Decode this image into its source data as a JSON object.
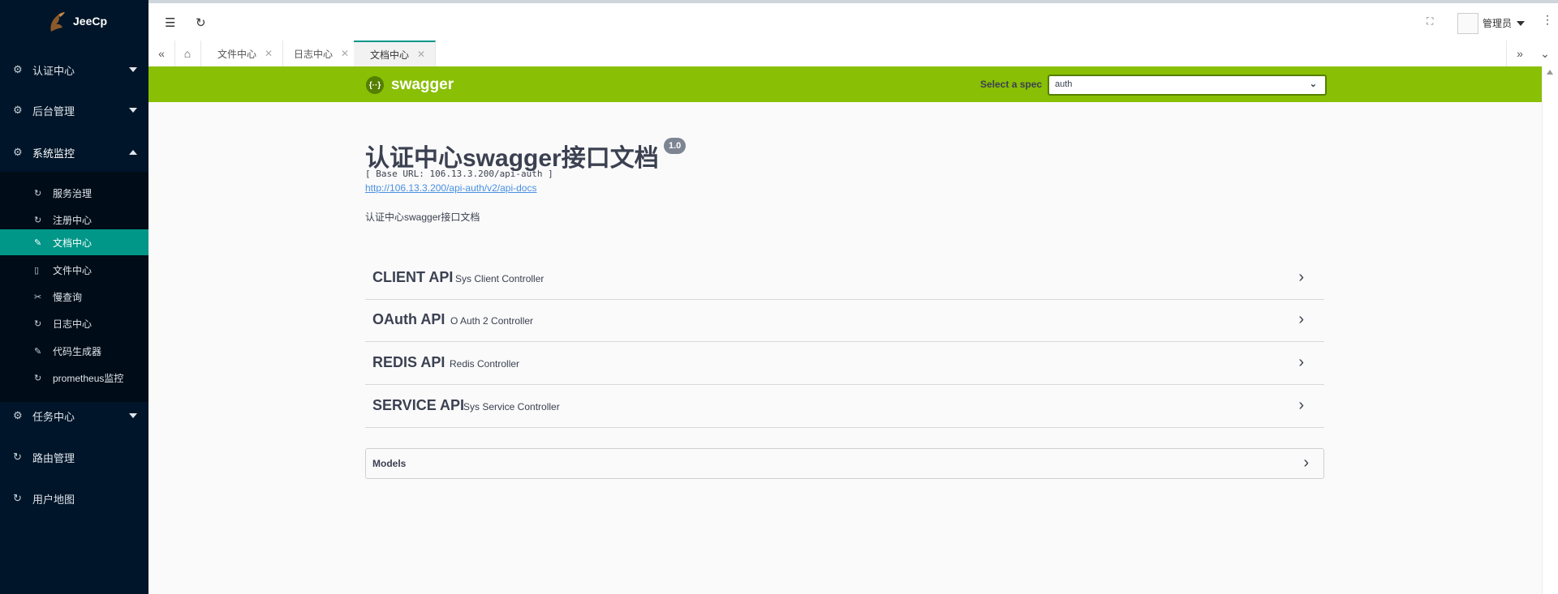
{
  "brand": {
    "title": "JeeCp"
  },
  "sidebar": {
    "groups": [
      {
        "label": "认证中心",
        "icon": "gear-icon",
        "expanded": false
      },
      {
        "label": "后台管理",
        "icon": "gear-icon",
        "expanded": false
      },
      {
        "label": "系统监控",
        "icon": "gear-icon",
        "expanded": true
      },
      {
        "label": "任务中心",
        "icon": "gear-icon",
        "expanded": false
      },
      {
        "label": "路由管理",
        "icon": "refresh-icon"
      },
      {
        "label": "用户地图",
        "icon": "refresh-icon"
      }
    ],
    "sub_items": [
      {
        "label": "服务治理",
        "icon": "refresh-icon"
      },
      {
        "label": "注册中心",
        "icon": "refresh-icon"
      },
      {
        "label": "文档中心",
        "icon": "document-edit-icon",
        "active": true
      },
      {
        "label": "文件中心",
        "icon": "file-icon"
      },
      {
        "label": "慢查询",
        "icon": "scissors-icon"
      },
      {
        "label": "日志中心",
        "icon": "refresh-icon"
      },
      {
        "label": "代码生成器",
        "icon": "document-edit-icon"
      },
      {
        "label": "prometheus监控",
        "icon": "refresh-icon"
      }
    ],
    "active_color": "#009688",
    "background_color": "#001529"
  },
  "header": {
    "user_name": "管理员",
    "icons": [
      "menu-toggle-icon",
      "refresh-icon",
      "fullscreen-icon",
      "more-icon"
    ]
  },
  "tabs": [
    {
      "label": "文件中心",
      "active": false
    },
    {
      "label": "日志中心",
      "active": false
    },
    {
      "label": "文档中心",
      "active": true
    }
  ],
  "swagger": {
    "brand_name": "swagger",
    "logo_text": "{··}",
    "spec_label": "Select a spec",
    "spec_value": "auth",
    "bar_color": "#89bf04",
    "title": "认证中心swagger接口文档",
    "version": "1.0",
    "base_url": "[ Base URL: 106.13.3.200/api-auth ]",
    "docs_link": "http://106.13.3.200/api-auth/v2/api-docs",
    "description": "认证中心swagger接口文档",
    "operations": [
      {
        "name": "CLIENT API",
        "desc": "Sys Client Controller"
      },
      {
        "name": "OAuth API",
        "desc": "O Auth 2 Controller"
      },
      {
        "name": "REDIS API",
        "desc": "Redis Controller"
      },
      {
        "name": "SERVICE API",
        "desc": "Sys Service Controller"
      }
    ],
    "models_label": "Models"
  }
}
